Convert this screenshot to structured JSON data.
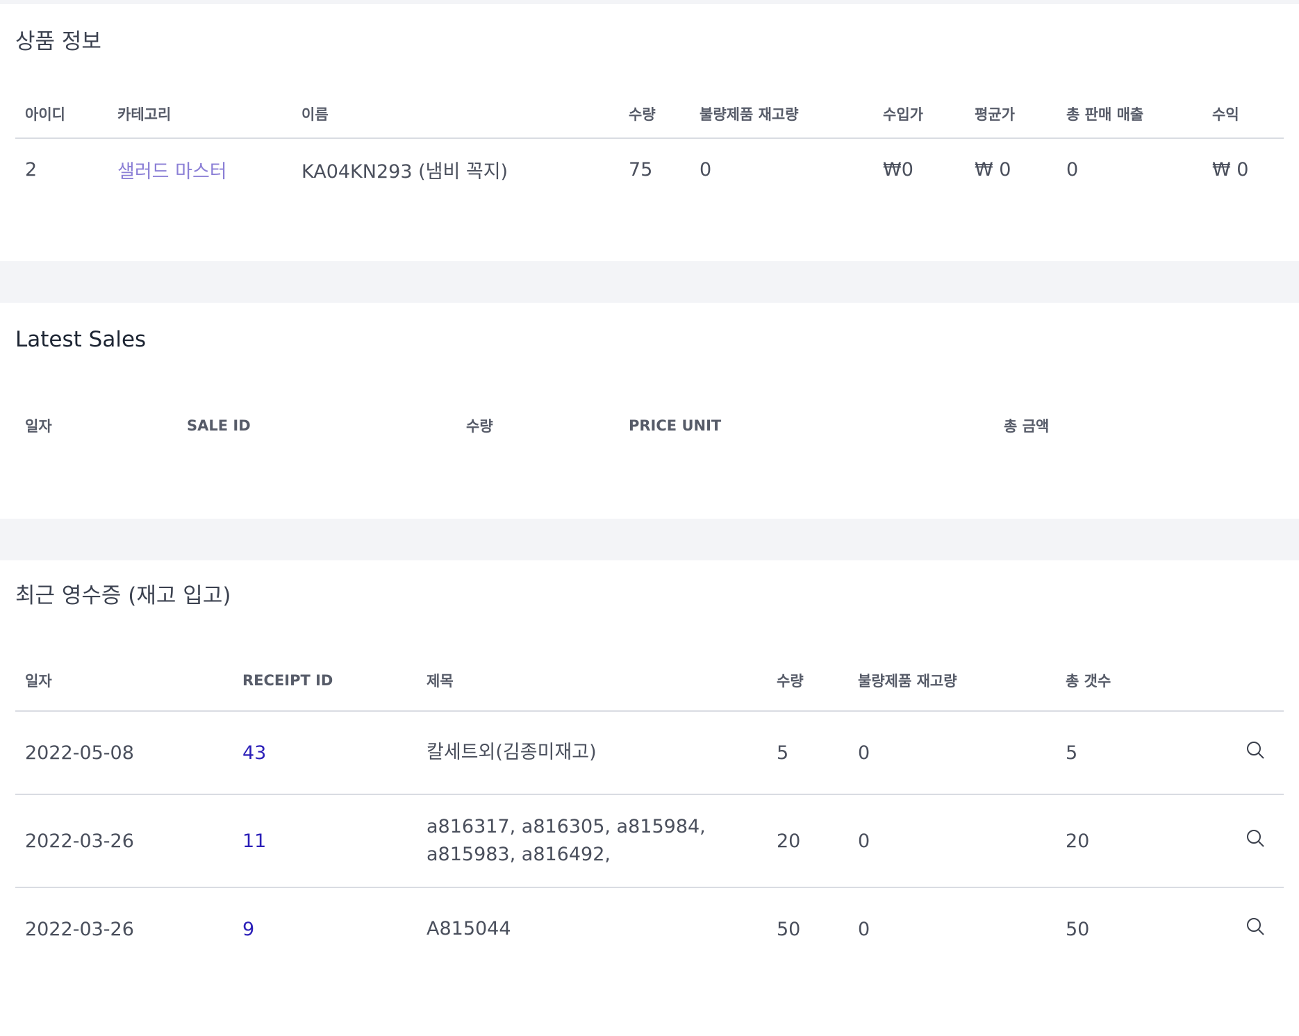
{
  "product_info": {
    "title": "상품 정보",
    "columns": [
      "아이디",
      "카테고리",
      "이름",
      "수량",
      "불량제품 재고량",
      "수입가",
      "평균가",
      "총 판매 매출",
      "수익"
    ],
    "row": {
      "id": "2",
      "category": "샐러드 마스터",
      "name": "KA04KN293 (냄비 꼭지)",
      "quantity": "75",
      "defective_stock": "0",
      "import_price": "₩0",
      "average_price": "₩ 0",
      "total_sales": "0",
      "profit": "₩ 0"
    }
  },
  "latest_sales": {
    "title": "Latest Sales",
    "columns": [
      "일자",
      "SALE ID",
      "수량",
      "PRICE UNIT",
      "총 금액"
    ]
  },
  "receipts": {
    "title": "최근 영수증 (재고 입고)",
    "columns": [
      "일자",
      "RECEIPT ID",
      "제목",
      "수량",
      "불량제품 재고량",
      "총 갯수"
    ],
    "rows": [
      {
        "date": "2022-05-08",
        "receipt_id": "43",
        "title_line1": "칼세트외(김종미재고)",
        "title_line2": "",
        "quantity": "5",
        "defective_stock": "0",
        "total_count": "5"
      },
      {
        "date": "2022-03-26",
        "receipt_id": "11",
        "title_line1": "a816317, a816305, a815984,",
        "title_line2": "a815983, a816492,",
        "quantity": "20",
        "defective_stock": "0",
        "total_count": "20"
      },
      {
        "date": "2022-03-26",
        "receipt_id": "9",
        "title_line1": "A815044",
        "title_line2": "",
        "quantity": "50",
        "defective_stock": "0",
        "total_count": "50"
      }
    ]
  },
  "colors": {
    "category_link": "#8b7fd6",
    "receipt_link": "#2b1fb8",
    "page_background": "#f3f4f7",
    "panel_background": "#ffffff"
  },
  "icons": {
    "row_action": "magnifier-icon"
  }
}
